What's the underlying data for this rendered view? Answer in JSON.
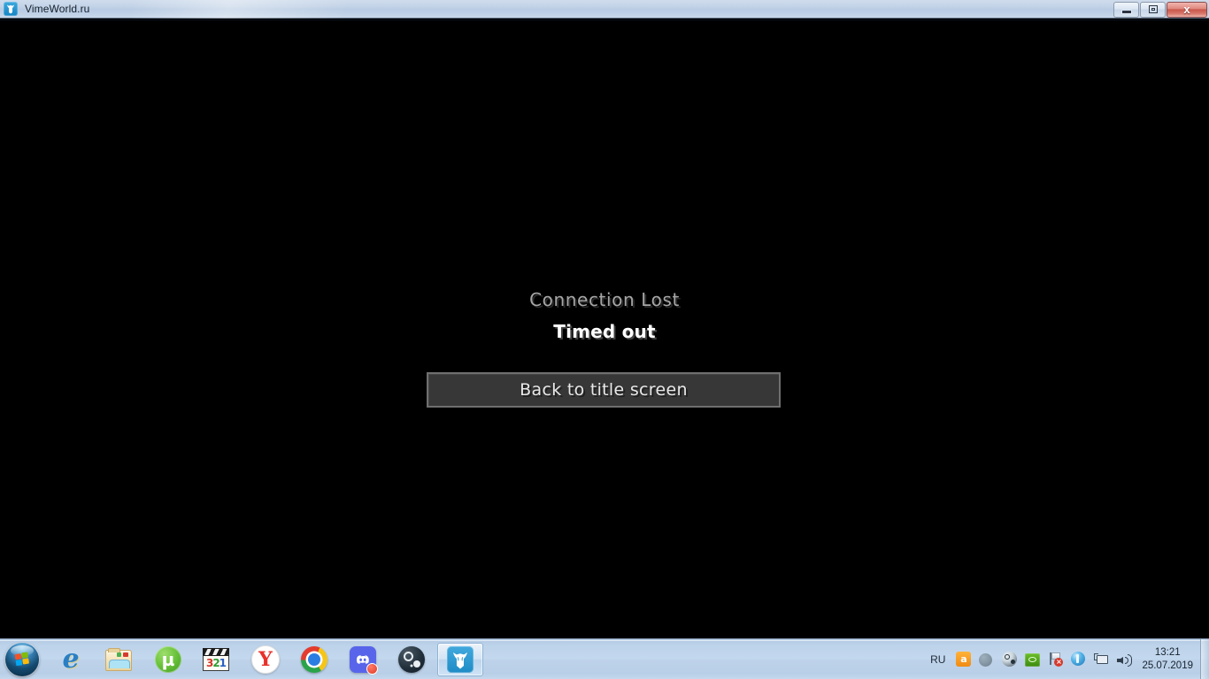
{
  "window": {
    "title": "VimeWorld.ru",
    "icon": "vimeworld-icon",
    "controls": {
      "minimize_label": "",
      "restore_label": "",
      "close_label": "x"
    }
  },
  "game": {
    "background_color": "#000000",
    "title": "Connection Lost",
    "title_color": "#a6a6a6",
    "reason": "Timed out",
    "reason_color": "#ffffff",
    "button_label": "Back to title screen",
    "button_fill": "#373737",
    "button_border": "#6f6f6f"
  },
  "taskbar": {
    "start_label": "",
    "items": [
      {
        "name": "internet-explorer",
        "label": "Internet Explorer",
        "active": false
      },
      {
        "name": "windows-explorer",
        "label": "Explorer",
        "active": false
      },
      {
        "name": "utorrent",
        "label": "µTorrent",
        "glyph": "µ",
        "active": false
      },
      {
        "name": "media-player-classic",
        "label": "Media Player Classic",
        "digits": [
          "3",
          "2",
          "1"
        ],
        "active": false
      },
      {
        "name": "yandex-browser",
        "label": "Yandex",
        "glyph": "Y",
        "active": false
      },
      {
        "name": "google-chrome",
        "label": "Google Chrome",
        "active": false
      },
      {
        "name": "discord",
        "label": "Discord",
        "active": false
      },
      {
        "name": "steam",
        "label": "Steam",
        "active": false
      },
      {
        "name": "vimeworld",
        "label": "VimeWorld.ru",
        "active": true
      }
    ],
    "tray": {
      "language": "RU",
      "icons": [
        {
          "name": "punto-switcher-icon",
          "glyph": "а"
        },
        {
          "name": "gray-circle-icon"
        },
        {
          "name": "steam-tray-icon"
        },
        {
          "name": "nvidia-settings-icon"
        },
        {
          "name": "action-center-flag-icon",
          "badge": "×"
        },
        {
          "name": "skype-icon"
        },
        {
          "name": "network-icon"
        },
        {
          "name": "volume-icon"
        }
      ],
      "clock": {
        "time": "13:21",
        "date": "25.07.2019"
      },
      "show_desktop_label": ""
    }
  }
}
